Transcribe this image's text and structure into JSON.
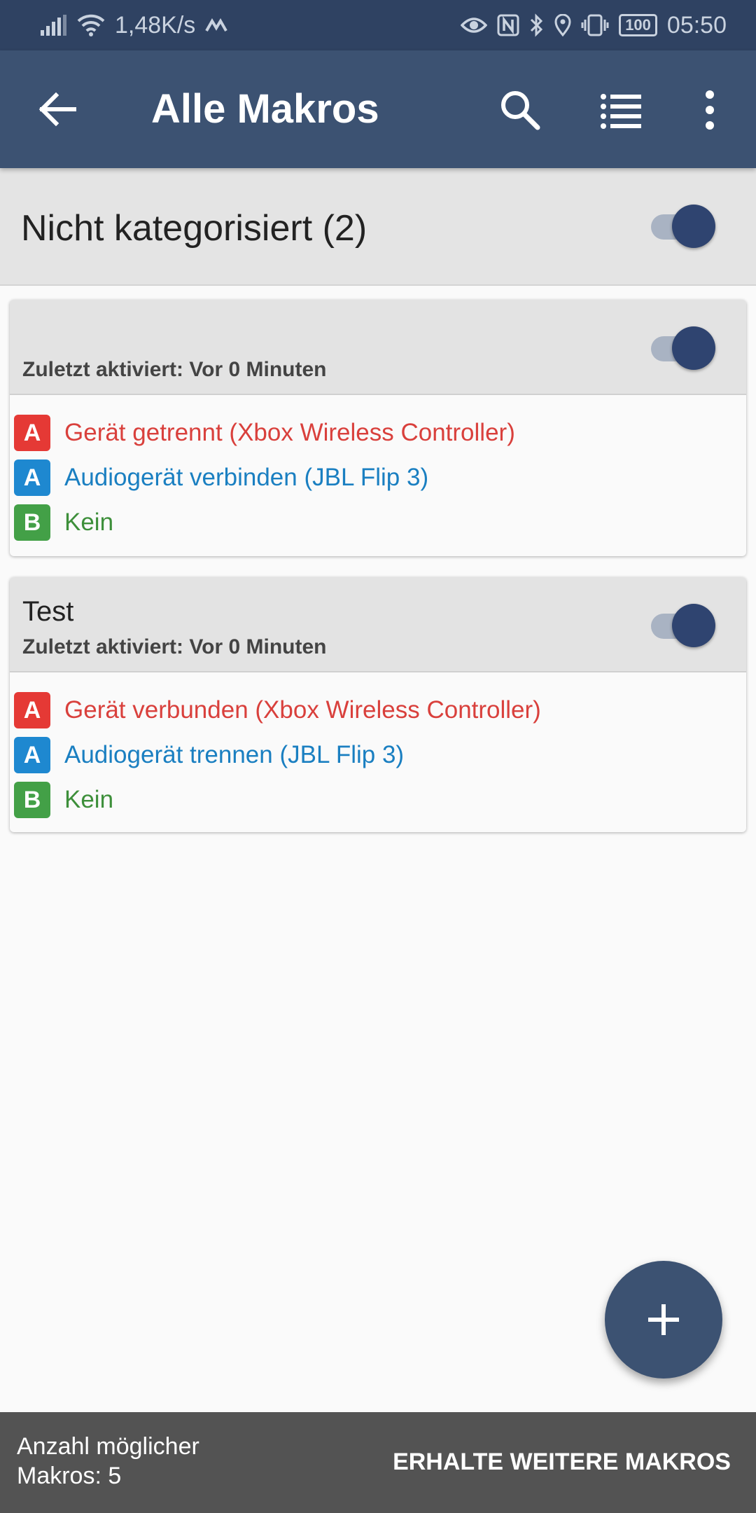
{
  "status_bar": {
    "network_speed": "1,48K/s",
    "battery": "100",
    "time": "05:50"
  },
  "app_bar": {
    "title": "Alle Makros",
    "icons": [
      "back-arrow-icon",
      "search-icon",
      "list-icon",
      "more-vert-icon"
    ]
  },
  "category": {
    "title": "Nicht kategorisiert (2)",
    "enabled": true
  },
  "macros": [
    {
      "name": "",
      "last_activated": "Zuletzt aktiviert: Vor 0 Minuten",
      "enabled": true,
      "rows": [
        {
          "badge": "A",
          "text": "Gerät getrennt (Xbox Wireless Controller)"
        },
        {
          "badge": "A",
          "text": "Audiogerät verbinden (JBL Flip 3)"
        },
        {
          "badge": "B",
          "text": "Kein"
        }
      ]
    },
    {
      "name": "Test",
      "last_activated": "Zuletzt aktiviert: Vor 0 Minuten",
      "enabled": true,
      "rows": [
        {
          "badge": "A",
          "text": "Gerät verbunden (Xbox Wireless Controller)"
        },
        {
          "badge": "A",
          "text": "Audiogerät trennen (JBL Flip 3)"
        },
        {
          "badge": "B",
          "text": "Kein"
        }
      ]
    }
  ],
  "colors": {
    "trigger": "#e53935",
    "action": "#1e88d0",
    "constraint": "#43a047",
    "trigger_text": "#d9403c",
    "action_text": "#1a7fc1",
    "constraint_text": "#3d8f3a",
    "primary": "#3c5272"
  },
  "bottom_bar": {
    "count_label_line1": "Anzahl möglicher",
    "count_label_line2": "Makros: 5",
    "action_label": "ERHALTE WEITERE MAKROS"
  },
  "fab_icon": "plus-icon"
}
